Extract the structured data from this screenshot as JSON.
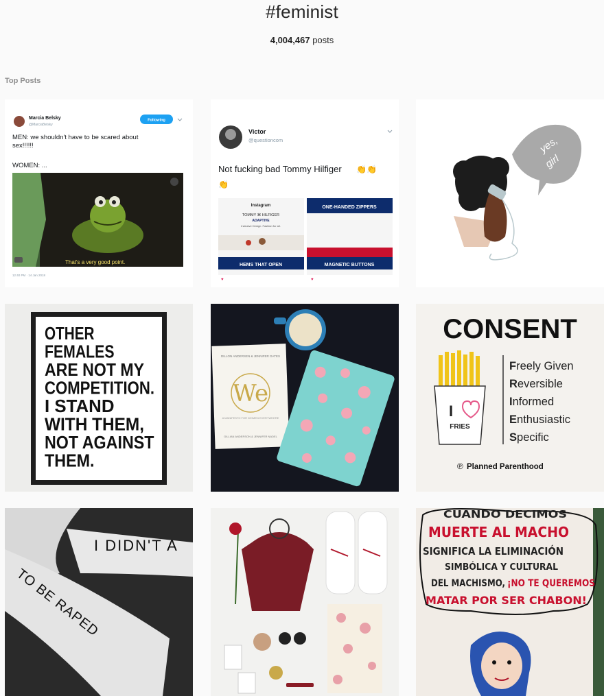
{
  "hashtag": "#feminist",
  "post_count": "4,004,467",
  "post_count_suffix": " posts",
  "section_title": "Top Posts",
  "colors": {
    "background": "#fafafa",
    "text": "#262626",
    "muted": "#8e8e8e",
    "blue": "#3897f0"
  },
  "posts": [
    {
      "author": "Marcia Belsky",
      "handle": "@MarciaBelsky",
      "follow_label": "Following",
      "line1": "MEN: we shouldn't have to be scared about",
      "line2": "sex!!!!!!",
      "line3": "WOMEN: ...",
      "caption": "That's a very good point.",
      "time": "12:40 PM · 14 Jan 2018"
    },
    {
      "author": "Victor",
      "handle": "@questioncom",
      "text": "Not fucking bad Tommy Hilfiger",
      "emoji": "👏👏",
      "emoji2": "👏",
      "app_title": "Instagram",
      "brand": "TOMMY ⌘ HILFIGER",
      "brand_sub": "ADAPTIVE",
      "brand_desc": "Inclusive Design. Fashion for all.",
      "banner1": "ONE-HANDED ZIPPERS",
      "banner2": "HEMS THAT OPEN",
      "banner3": "MAGNETIC BUTTONS"
    },
    {
      "bubble1": "yes,",
      "bubble2": "girl"
    },
    {
      "lines": [
        "OTHER",
        "FEMALES",
        "ARE NOT MY",
        "COMPETITION.",
        "I STAND",
        "WITH THEM,",
        "NOT AGAINST",
        "THEM."
      ]
    },
    {
      "book_author": "DILLON ANDERSEN & JENNIFER GATES",
      "book_title": "We",
      "book_sub": "A MANIFESTO FOR WOMEN EVERYWHERE",
      "book_foot": "GILLIAN ANDERSON & JENNIFER NADEL"
    },
    {
      "title": "CONSENT",
      "items": [
        {
          "initial": "F",
          "rest": "reely Given"
        },
        {
          "initial": "R",
          "rest": "eversible"
        },
        {
          "initial": "I",
          "rest": "nformed"
        },
        {
          "initial": "E",
          "rest": "nthusiastic"
        },
        {
          "initial": "S",
          "rest": "pecific"
        }
      ],
      "carton_text": "FRIES",
      "carton_letter": "I",
      "brand": "Planned Parenthood"
    },
    {
      "text1": "I DIDN'T A",
      "text2": "TO BE RAPED"
    },
    {},
    {
      "lines": [
        "CUANDO DECIMOS",
        "MUERTE AL MACHO",
        "SIGNIFICA LA ELIMINACIÓN",
        "SIMBÓLICA Y CULTURAL",
        "DEL MACHISMO,",
        "¡NO TE QUEREMOS",
        "MATAR POR SER CHABON!"
      ]
    }
  ]
}
